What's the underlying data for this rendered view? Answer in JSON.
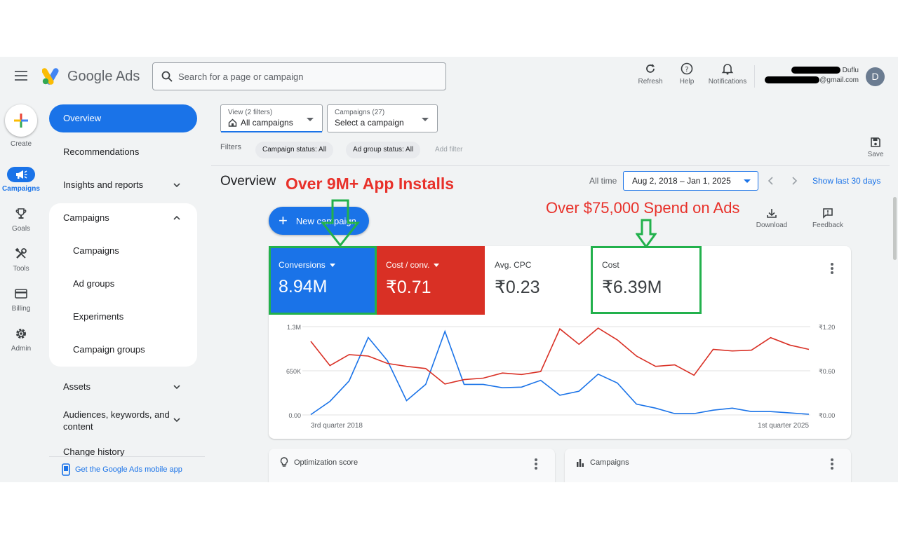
{
  "header": {
    "logo_text": "Google Ads",
    "search_placeholder": "Search for a page or campaign",
    "refresh_label": "Refresh",
    "help_label": "Help",
    "notifications_label": "Notifications",
    "account_name": "Duflu",
    "account_email_suffix": "@gmail.com",
    "avatar_letter": "D"
  },
  "rail": {
    "create_label": "Create",
    "campaigns_label": "Campaigns",
    "goals_label": "Goals",
    "tools_label": "Tools",
    "billing_label": "Billing",
    "admin_label": "Admin"
  },
  "nav": {
    "overview": "Overview",
    "recommendations": "Recommendations",
    "insights": "Insights and reports",
    "campaigns_group": "Campaigns",
    "sub_campaigns": "Campaigns",
    "sub_ad_groups": "Ad groups",
    "sub_experiments": "Experiments",
    "sub_campaign_groups": "Campaign groups",
    "assets": "Assets",
    "audiences_line1": "Audiences, keywords, and",
    "audiences_line2": "content",
    "change_history": "Change history",
    "mobile_app": "Get the Google Ads mobile app"
  },
  "filters": {
    "view_small": "View (2 filters)",
    "view_value": "All campaigns",
    "campaigns_small": "Campaigns (27)",
    "campaigns_value": "Select a campaign",
    "filters_label": "Filters",
    "chip_campaign_status": "Campaign status: All",
    "chip_ad_group_status": "Ad group status: All",
    "add_filter": "Add filter",
    "save_label": "Save"
  },
  "overview": {
    "title": "Overview",
    "all_time": "All time",
    "date_range": "Aug 2, 2018 – Jan 1, 2025",
    "show_last_30": "Show last 30 days",
    "new_campaign": "New campaign",
    "download": "Download",
    "feedback": "Feedback"
  },
  "annotations": {
    "installs": "Over 9M+ App Installs",
    "spend": "Over $75,000 Spend on Ads",
    "box_color": "#22b14c",
    "text_color": "#e8312a"
  },
  "metrics": [
    {
      "name": "Conversions",
      "value": "8.94M"
    },
    {
      "name": "Cost / conv.",
      "value": "₹0.71"
    },
    {
      "name": "Avg. CPC",
      "value": "₹0.23"
    },
    {
      "name": "Cost",
      "value": "₹6.39M"
    }
  ],
  "chart_data": {
    "type": "line",
    "x_start_label": "3rd quarter 2018",
    "x_end_label": "1st quarter 2025",
    "y_left_ticks": [
      "1.3M",
      "650K",
      "0.00"
    ],
    "y_right_ticks": [
      "₹1.20",
      "₹0.60",
      "₹0.00"
    ],
    "y_left_range": [
      0,
      1300000
    ],
    "y_right_range": [
      0,
      1.2
    ],
    "series": [
      {
        "name": "Conversions",
        "color": "#1a73e8",
        "axis": "left",
        "values": [
          5000,
          200000,
          500000,
          1140000,
          800000,
          210000,
          450000,
          1230000,
          450000,
          450000,
          400000,
          410000,
          510000,
          290000,
          350000,
          600000,
          470000,
          160000,
          100000,
          20000,
          20000,
          70000,
          100000,
          50000,
          50000,
          30000,
          10000
        ]
      },
      {
        "name": "Cost / conv.",
        "color": "#d93025",
        "axis": "right",
        "values": [
          1.0,
          0.67,
          0.82,
          0.8,
          0.7,
          0.66,
          0.63,
          0.42,
          0.48,
          0.5,
          0.57,
          0.55,
          0.59,
          1.17,
          0.96,
          1.18,
          1.02,
          0.8,
          0.66,
          0.68,
          0.54,
          0.89,
          0.87,
          0.88,
          1.05,
          0.95,
          0.89
        ]
      }
    ]
  },
  "bottom_cards": {
    "optimization": "Optimization score",
    "campaigns": "Campaigns"
  }
}
